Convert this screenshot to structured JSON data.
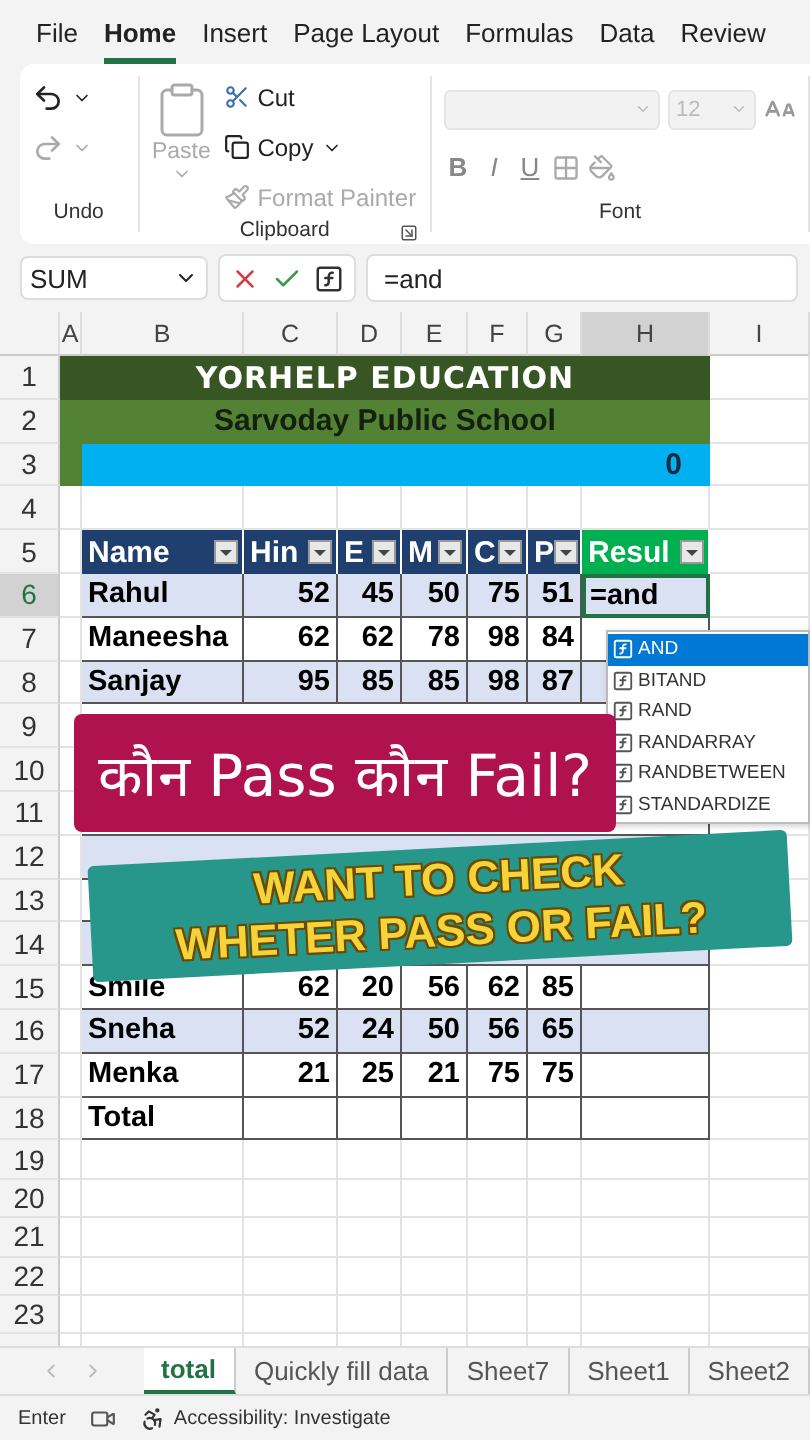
{
  "ribbon_tabs": [
    {
      "label": "File",
      "selected": false
    },
    {
      "label": "Home",
      "selected": true
    },
    {
      "label": "Insert",
      "selected": false
    },
    {
      "label": "Page Layout",
      "selected": false
    },
    {
      "label": "Formulas",
      "selected": false
    },
    {
      "label": "Data",
      "selected": false
    },
    {
      "label": "Review",
      "selected": false
    }
  ],
  "ribbon": {
    "undo_group": {
      "label": "Undo"
    },
    "clipboard_group": {
      "label": "Clipboard",
      "paste": "Paste",
      "cut": "Cut",
      "copy": "Copy",
      "format_painter": "Format Painter"
    },
    "font_group": {
      "label": "Font",
      "font_size": "12",
      "bold": "B",
      "italic": "I",
      "underline": "U"
    }
  },
  "formula_bar": {
    "name_box": "SUM",
    "formula": "=and"
  },
  "columns": [
    {
      "label": "A",
      "selected": false
    },
    {
      "label": "B",
      "selected": false
    },
    {
      "label": "C",
      "selected": false
    },
    {
      "label": "D",
      "selected": false
    },
    {
      "label": "E",
      "selected": false
    },
    {
      "label": "F",
      "selected": false
    },
    {
      "label": "G",
      "selected": false
    },
    {
      "label": "H",
      "selected": true
    },
    {
      "label": "I",
      "selected": false
    }
  ],
  "rows": [
    {
      "number": "1",
      "kind": "title",
      "selected": false,
      "text": "YORHELP EDUCATION"
    },
    {
      "number": "2",
      "kind": "subtitle",
      "selected": false,
      "text": "Sarvoday Public School"
    },
    {
      "number": "3",
      "kind": "value",
      "selected": false,
      "text": "0"
    },
    {
      "number": "4",
      "kind": "blank",
      "selected": false
    },
    {
      "number": "5",
      "kind": "header",
      "selected": false,
      "headers": [
        {
          "label": "Name",
          "color": "#1f3f6e"
        },
        {
          "label": "Hin",
          "color": "#1f3f6e"
        },
        {
          "label": "E",
          "color": "#1f3f6e"
        },
        {
          "label": "M",
          "color": "#1f3f6e"
        },
        {
          "label": "C",
          "color": "#1f3f6e"
        },
        {
          "label": "P",
          "color": "#1f3f6e"
        },
        {
          "label": "Resul",
          "color": "#00b050"
        }
      ]
    },
    {
      "number": "6",
      "kind": "data",
      "selected": true,
      "name": "Rahul",
      "scores": [
        "52",
        "45",
        "50",
        "75",
        "51"
      ],
      "result": "=and"
    },
    {
      "number": "7",
      "kind": "data",
      "selected": false,
      "name": "Maneesha",
      "scores": [
        "62",
        "62",
        "78",
        "98",
        "84"
      ]
    },
    {
      "number": "8",
      "kind": "data",
      "selected": false,
      "name": "Sanjay",
      "scores": [
        "95",
        "85",
        "85",
        "98",
        "87"
      ]
    },
    {
      "number": "9",
      "kind": "data",
      "selected": false
    },
    {
      "number": "10",
      "kind": "data",
      "selected": false
    },
    {
      "number": "11",
      "kind": "data",
      "selected": false
    },
    {
      "number": "12",
      "kind": "data",
      "selected": false
    },
    {
      "number": "13",
      "kind": "data",
      "selected": false
    },
    {
      "number": "14",
      "kind": "data",
      "selected": false
    },
    {
      "number": "15",
      "kind": "data",
      "selected": false,
      "name": "Smile",
      "scores": [
        "62",
        "20",
        "56",
        "62",
        "85"
      ]
    },
    {
      "number": "16",
      "kind": "data",
      "selected": false,
      "name": "Sneha",
      "scores": [
        "52",
        "24",
        "50",
        "56",
        "65"
      ]
    },
    {
      "number": "17",
      "kind": "data",
      "selected": false,
      "name": "Menka",
      "scores": [
        "21",
        "25",
        "21",
        "75",
        "75"
      ]
    },
    {
      "number": "18",
      "kind": "total",
      "selected": false,
      "name": "Total"
    },
    {
      "number": "19",
      "kind": "blank",
      "selected": false
    },
    {
      "number": "20",
      "kind": "blank",
      "selected": false
    },
    {
      "number": "21",
      "kind": "blank",
      "selected": false
    },
    {
      "number": "22",
      "kind": "blank",
      "selected": false
    },
    {
      "number": "23",
      "kind": "blank",
      "selected": false
    }
  ],
  "autocomplete": [
    {
      "label": "AND",
      "selected": true
    },
    {
      "label": "BITAND",
      "selected": false
    },
    {
      "label": "RAND",
      "selected": false
    },
    {
      "label": "RANDARRAY",
      "selected": false
    },
    {
      "label": "RANDBETWEEN",
      "selected": false
    },
    {
      "label": "STANDARDIZE",
      "selected": false
    }
  ],
  "banner": {
    "text": "कौन Pass कौन Fail?"
  },
  "callout": {
    "lines": [
      "WANT TO CHECK",
      "WHETER PASS OR FAIL?"
    ]
  },
  "sheet_tabs": [
    {
      "label": "total",
      "selected": true
    },
    {
      "label": "Quickly fill data",
      "selected": false
    },
    {
      "label": "Sheet7",
      "selected": false
    },
    {
      "label": "Sheet1",
      "selected": false
    },
    {
      "label": "Sheet2",
      "selected": false
    }
  ],
  "status_bar": {
    "mode": "Enter",
    "accessibility": "Accessibility: Investigate"
  }
}
